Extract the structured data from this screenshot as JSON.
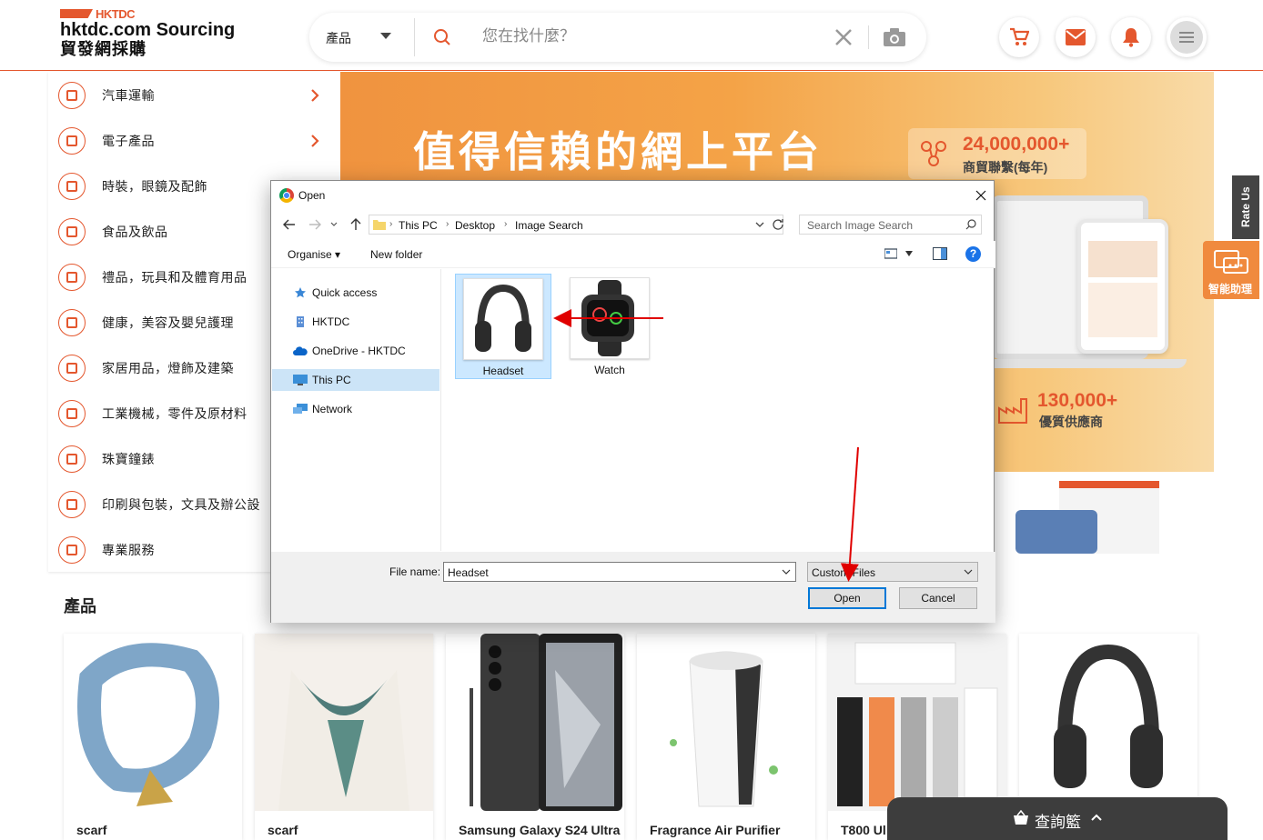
{
  "header": {
    "brand_small": "HKTDC",
    "title": "hktdc.com Sourcing",
    "subtitle": "貿發網採購",
    "search": {
      "category": "產品",
      "placeholder": "您在找什麼？"
    }
  },
  "categories": [
    {
      "label": "汽車運輸",
      "has_arrow": true
    },
    {
      "label": "電子產品",
      "has_arrow": true
    },
    {
      "label": "時裝，眼鏡及配飾",
      "has_arrow": true
    },
    {
      "label": "食品及飲品",
      "has_arrow": false
    },
    {
      "label": "禮品，玩具和及體育用品",
      "has_arrow": false
    },
    {
      "label": "健康，美容及嬰兒護理",
      "has_arrow": false
    },
    {
      "label": "家居用品，燈飾及建築",
      "has_arrow": false
    },
    {
      "label": "工業機械，零件及原材料",
      "has_arrow": false
    },
    {
      "label": "珠寶鐘錶",
      "has_arrow": false
    },
    {
      "label": "印刷與包裝，文具及辦公設",
      "has_arrow": false
    },
    {
      "label": "專業服務",
      "has_arrow": false
    }
  ],
  "banner": {
    "title": "值得信賴的網上平台",
    "stat1_number": "24,000,000+",
    "stat1_label": "商貿聯繫(每年)",
    "stat2_number": "130,000+",
    "stat2_label": "優質供應商"
  },
  "side": {
    "rate_us": "Rate Us",
    "assistant": "智能助理"
  },
  "products": {
    "heading": "產品",
    "items": [
      {
        "name": "scarf"
      },
      {
        "name": "scarf"
      },
      {
        "name": "Samsung Galaxy S24 Ultra"
      },
      {
        "name": "Fragrance Air Purifier"
      },
      {
        "name": "T800 Ul"
      },
      {
        "name": ""
      }
    ]
  },
  "inquiry_basket": {
    "label": "查詢籃"
  },
  "dialog": {
    "title": "Open",
    "breadcrumb": [
      "This PC",
      "Desktop",
      "Image Search"
    ],
    "search_placeholder": "Search Image Search",
    "toolbar": {
      "organise": "Organise ▾",
      "new_folder": "New folder"
    },
    "nav_items": [
      {
        "label": "Quick access",
        "icon": "star-icon"
      },
      {
        "label": "HKTDC",
        "icon": "building-icon"
      },
      {
        "label": "OneDrive - HKTDC",
        "icon": "cloud-icon"
      },
      {
        "label": "This PC",
        "icon": "monitor-icon",
        "selected": true
      },
      {
        "label": "Network",
        "icon": "network-icon"
      }
    ],
    "files": [
      {
        "label": "Headset",
        "selected": true
      },
      {
        "label": "Watch",
        "selected": false
      }
    ],
    "filename_label": "File name:",
    "filename_value": "Headset",
    "filetype_value": "Custom Files",
    "open_button": "Open",
    "cancel_button": "Cancel"
  },
  "colors": {
    "accent": "#e4572e",
    "banner_orange": "#f4a347",
    "selection_blue": "#cce8ff",
    "annotation_red": "#e00000"
  }
}
